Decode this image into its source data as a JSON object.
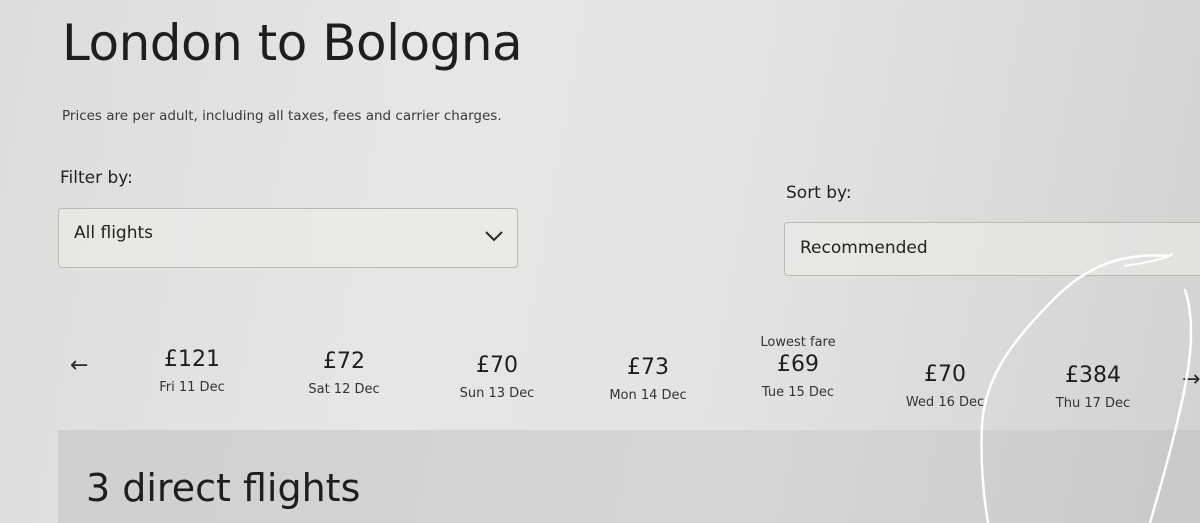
{
  "header": {
    "title": "London to Bologna",
    "subtitle": "Prices are per adult, including all taxes, fees and carrier charges."
  },
  "filter": {
    "label": "Filter by:",
    "value": "All flights"
  },
  "sort": {
    "label": "Sort by:",
    "value": "Recommended"
  },
  "date_strip": {
    "prev_icon": "arrow-left-icon",
    "next_icon": "arrow-right-icon",
    "tabs": [
      {
        "flag": "",
        "price": "£121",
        "date": "Fri 11 Dec"
      },
      {
        "flag": "",
        "price": "£72",
        "date": "Sat 12 Dec"
      },
      {
        "flag": "",
        "price": "£70",
        "date": "Sun 13 Dec"
      },
      {
        "flag": "",
        "price": "£73",
        "date": "Mon 14 Dec"
      },
      {
        "flag": "Lowest fare",
        "price": "£69",
        "date": "Tue 15 Dec"
      },
      {
        "flag": "",
        "price": "£70",
        "date": "Wed 16 Dec"
      },
      {
        "flag": "",
        "price": "£384",
        "date": "Thu 17 Dec"
      }
    ]
  },
  "results": {
    "title": "3 direct flights"
  },
  "colors": {
    "background": "#e3e3e1",
    "text": "#1e1e1e",
    "annotation": "#ffffff"
  }
}
